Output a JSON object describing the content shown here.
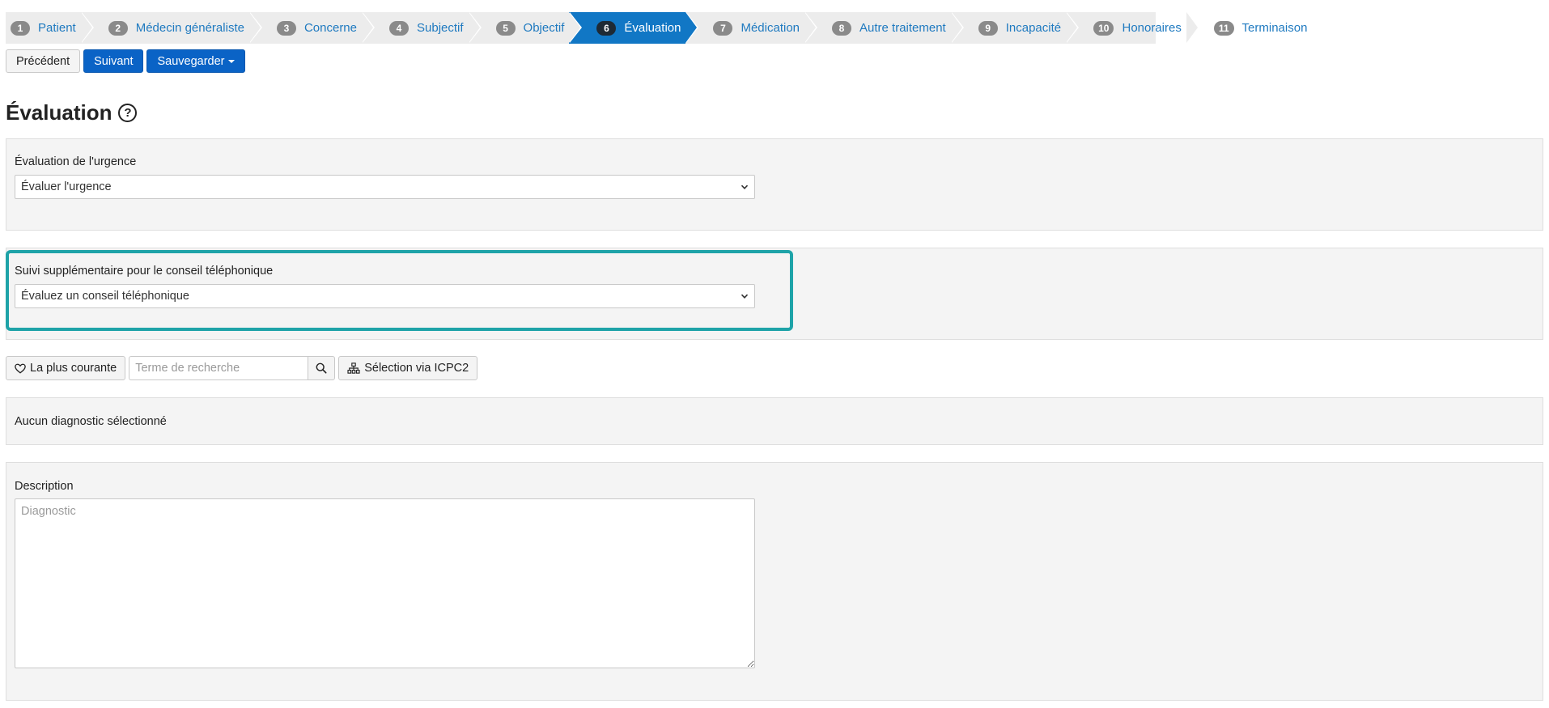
{
  "wizard": {
    "steps": [
      {
        "num": "1",
        "label": "Patient"
      },
      {
        "num": "2",
        "label": "Médecin généraliste"
      },
      {
        "num": "3",
        "label": "Concerne"
      },
      {
        "num": "4",
        "label": "Subjectif"
      },
      {
        "num": "5",
        "label": "Objectif"
      },
      {
        "num": "6",
        "label": "Évaluation"
      },
      {
        "num": "7",
        "label": "Médication"
      },
      {
        "num": "8",
        "label": "Autre traitement"
      },
      {
        "num": "9",
        "label": "Incapacité"
      },
      {
        "num": "10",
        "label": "Honoraires"
      },
      {
        "num": "11",
        "label": "Terminaison"
      }
    ],
    "active_index": 5
  },
  "nav": {
    "previous_label": "Précédent",
    "next_label": "Suivant",
    "save_label": "Sauvegarder"
  },
  "page": {
    "title": "Évaluation",
    "help_glyph": "?"
  },
  "urgency": {
    "label": "Évaluation de l'urgence",
    "selected": "Évaluer l'urgence"
  },
  "phone_followup": {
    "label": "Suivi supplémentaire pour le conseil téléphonique",
    "selected": "Évaluez un conseil téléphonique"
  },
  "search": {
    "favorites_label": "La plus courante",
    "placeholder": "Terme de recherche",
    "icpc_label": "Sélection via ICPC2"
  },
  "diagnosis": {
    "empty_text": "Aucun diagnostic sélectionné"
  },
  "description": {
    "label": "Description",
    "placeholder": "Diagnostic"
  },
  "colors": {
    "primary": "#0a63c6",
    "active_step": "#1177c5",
    "link": "#1f7ac0",
    "highlight": "#1ea3a8"
  }
}
